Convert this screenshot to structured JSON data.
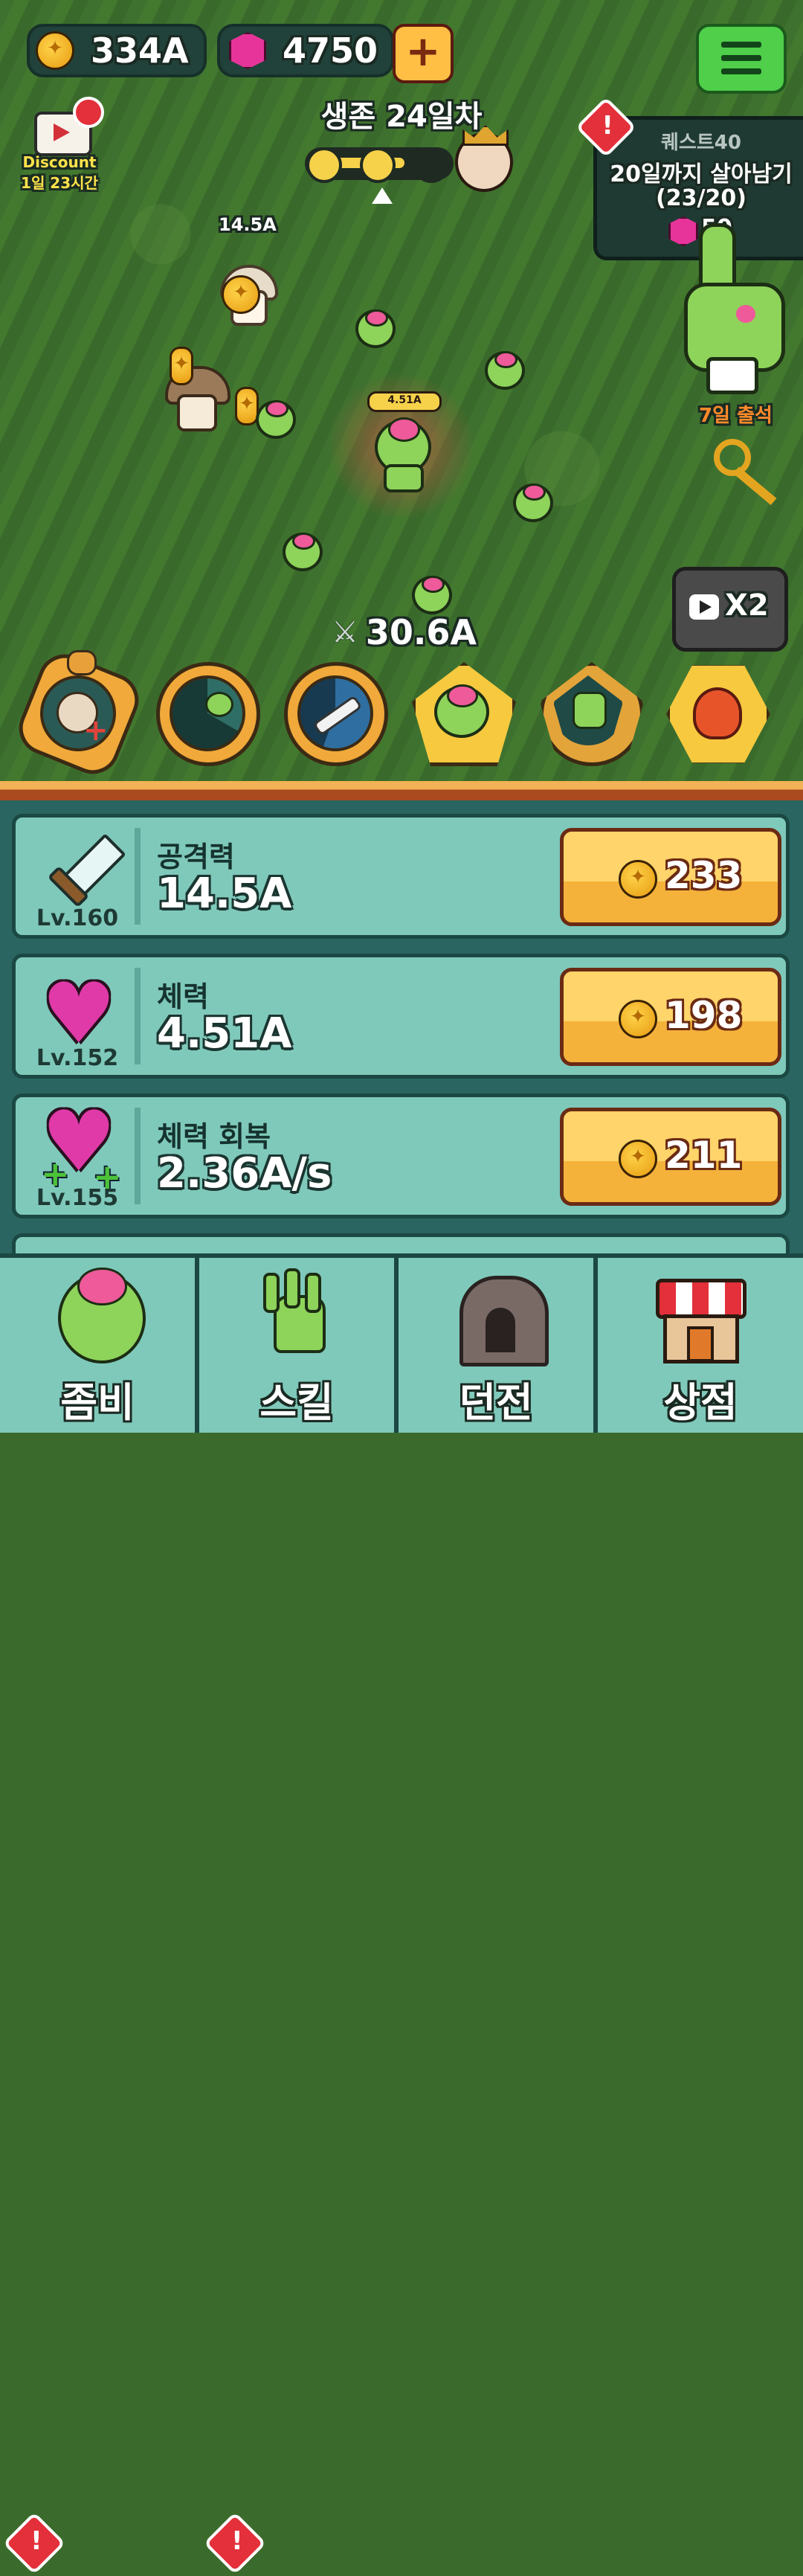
{
  "top": {
    "gold": "334A",
    "gems": "4750",
    "plus_label": "+",
    "discount": {
      "label": "Discount",
      "timer": "1일 23시간"
    }
  },
  "stage": {
    "title": "생존 24일차"
  },
  "quest": {
    "title": "퀘스트40",
    "desc": "20일까지 살아남기",
    "progress": "(23/20)",
    "reward": "50"
  },
  "attendance": {
    "label": "7일 출석"
  },
  "field": {
    "floating_damage": "14.5A",
    "player_hp": "4.51A",
    "power": "30.6A",
    "speed_button": "X2"
  },
  "skills": [
    {
      "icon": "shell-heal-icon"
    },
    {
      "icon": "zombie-slash-icon"
    },
    {
      "icon": "bone-whirl-icon"
    },
    {
      "icon": "zombie-summon-icon"
    },
    {
      "icon": "zombie-rise-icon"
    },
    {
      "icon": "rage-flame-icon"
    }
  ],
  "stats": [
    {
      "name": "공격력",
      "value": "14.5A",
      "level": "Lv.160",
      "cost": "233",
      "icon": "sword-icon"
    },
    {
      "name": "체력",
      "value": "4.51A",
      "level": "Lv.152",
      "cost": "198",
      "icon": "heart-icon"
    },
    {
      "name": "체력 회복",
      "value": "2.36A/s",
      "level": "Lv.155",
      "cost": "211",
      "icon": "heart-regen-icon"
    }
  ],
  "nav": [
    {
      "label": "좀비",
      "icon": "zombie-icon",
      "alert": true
    },
    {
      "label": "스킬",
      "icon": "zombie-hand-icon",
      "alert": true
    },
    {
      "label": "던전",
      "icon": "dungeon-gate-icon",
      "alert": false
    },
    {
      "label": "상점",
      "icon": "shop-icon",
      "alert": false
    }
  ],
  "colors": {
    "panel": "#2a6561",
    "row": "#7fc9bb",
    "button": "#ffc84e",
    "grass": "#3e712f"
  }
}
